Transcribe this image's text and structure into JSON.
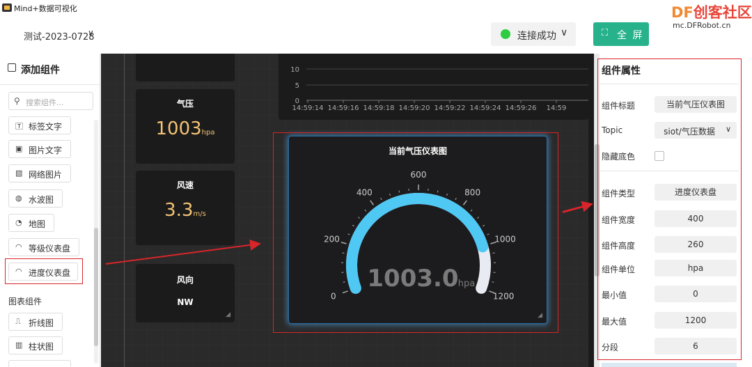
{
  "window": {
    "title": "Mind+数据可视化"
  },
  "header": {
    "project_name": "测试-2023-0728",
    "connection": {
      "label": "连接成功",
      "status_color": "#2ecc40"
    },
    "fullscreen_label": "全 屏",
    "brand_df": "DF",
    "brand_text": "创客社区",
    "brand_url": "mc.DFRobot.cn"
  },
  "left_panel": {
    "title": "添加组件",
    "search_placeholder": "搜索组件...",
    "components": [
      {
        "label": "标签文字",
        "icon": "text-label-icon"
      },
      {
        "label": "图片文字",
        "icon": "image-text-icon"
      },
      {
        "label": "网络图片",
        "icon": "web-image-icon"
      },
      {
        "label": "水波图",
        "icon": "water-wave-icon"
      },
      {
        "label": "地图",
        "icon": "map-icon"
      },
      {
        "label": "等级仪表盘",
        "icon": "level-gauge-icon"
      },
      {
        "label": "进度仪表盘",
        "icon": "progress-gauge-icon"
      }
    ],
    "chart_section_label": "图表组件",
    "chart_components": [
      {
        "label": "折线图",
        "icon": "line-chart-icon"
      },
      {
        "label": "柱状图",
        "icon": "bar-chart-icon"
      }
    ]
  },
  "canvas": {
    "cards": [
      {
        "title": "气压",
        "value": "1003",
        "unit": "hpa"
      },
      {
        "title": "风速",
        "value": "3.3",
        "unit": "m/s"
      },
      {
        "title": "风向",
        "text": "NW"
      }
    ],
    "line_chart": {
      "y_ticks": [
        "10",
        "5",
        "0"
      ],
      "x_ticks": [
        "14:59:14",
        "14:59:16",
        "14:59:18",
        "14:59:20",
        "14:59:22",
        "14:59:24",
        "14:59:26",
        "14:59"
      ]
    },
    "gauge": {
      "title": "当前气压仪表图",
      "value": 1003.0,
      "value_text": "1003.0",
      "unit": "hpa",
      "min": 0,
      "max": 1200,
      "tick_labels": [
        "0",
        "200",
        "400",
        "600",
        "800",
        "1000",
        "1200"
      ],
      "arc_color": "#4fc8f4",
      "track_color": "#e8ecf2"
    }
  },
  "right_panel": {
    "title": "组件属性",
    "props": {
      "title_label": "组件标题",
      "title_value": "当前气压仪表图",
      "topic_label": "Topic",
      "topic_value": "siot/气压数据",
      "hide_bg_label": "隐藏底色",
      "type_label": "组件类型",
      "type_value": "进度仪表盘",
      "width_label": "组件宽度",
      "width_value": "400",
      "height_label": "组件高度",
      "height_value": "260",
      "unit_label": "组件单位",
      "unit_value": "hpa",
      "min_label": "最小值",
      "min_value": "0",
      "max_label": "最大值",
      "max_value": "1200",
      "seg_label": "分段",
      "seg_value": "6"
    }
  },
  "colors": {
    "accent_green": "#27b28c",
    "highlight_red": "#d9252a",
    "canvas_bg": "#2a2a2a"
  }
}
